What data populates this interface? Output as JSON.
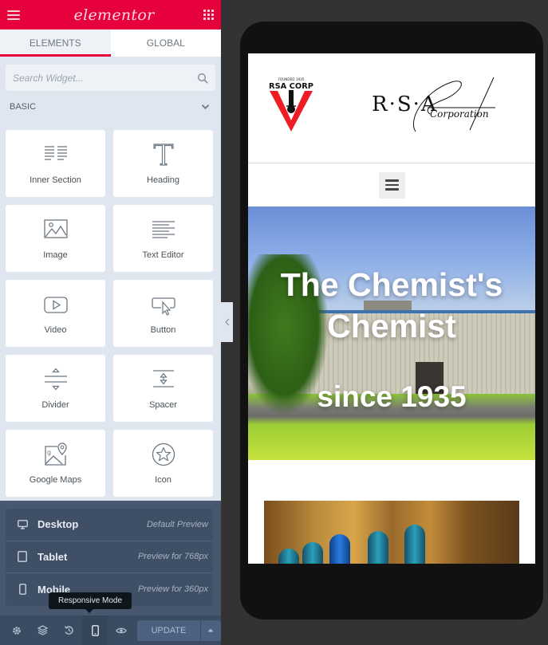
{
  "panel": {
    "logo_text": "elementor",
    "tabs": [
      {
        "label": "ELEMENTS",
        "active": true
      },
      {
        "label": "GLOBAL",
        "active": false
      }
    ],
    "search": {
      "placeholder": "Search Widget..."
    },
    "category": {
      "label": "BASIC",
      "expanded": true
    },
    "widgets": [
      {
        "label": "Inner Section",
        "icon": "inner-section-icon"
      },
      {
        "label": "Heading",
        "icon": "heading-icon"
      },
      {
        "label": "Image",
        "icon": "image-icon"
      },
      {
        "label": "Text Editor",
        "icon": "text-editor-icon"
      },
      {
        "label": "Video",
        "icon": "video-icon"
      },
      {
        "label": "Button",
        "icon": "button-icon"
      },
      {
        "label": "Divider",
        "icon": "divider-icon"
      },
      {
        "label": "Spacer",
        "icon": "spacer-icon"
      },
      {
        "label": "Google Maps",
        "icon": "google-maps-icon"
      },
      {
        "label": "Icon",
        "icon": "star-icon"
      }
    ],
    "responsive_menu": [
      {
        "name": "Desktop",
        "desc": "Default Preview",
        "icon": "desktop-icon"
      },
      {
        "name": "Tablet",
        "desc": "Preview for 768px",
        "icon": "tablet-icon"
      },
      {
        "name": "Mobile",
        "desc": "Preview for 360px",
        "icon": "mobile-icon"
      }
    ],
    "tooltip": "Responsive Mode",
    "footer": {
      "buttons": [
        "settings-icon",
        "navigator-icon",
        "history-icon",
        "responsive-mode-icon",
        "preview-icon"
      ],
      "update_label": "UPDATE"
    }
  },
  "preview": {
    "logo_badge": {
      "founded": "FOUNDED 1935",
      "name": "RSA CORP"
    },
    "logo_script": {
      "initials": "R·S·A",
      "word": "Corporation"
    },
    "hero": {
      "title": "The Chemist's Chemist",
      "subtitle": "since 1935"
    }
  },
  "colors": {
    "brand": "#e6003c",
    "panel_bg": "#dfe6ef",
    "footer_bg": "#3b4c62",
    "canvas_bg": "#333333"
  }
}
